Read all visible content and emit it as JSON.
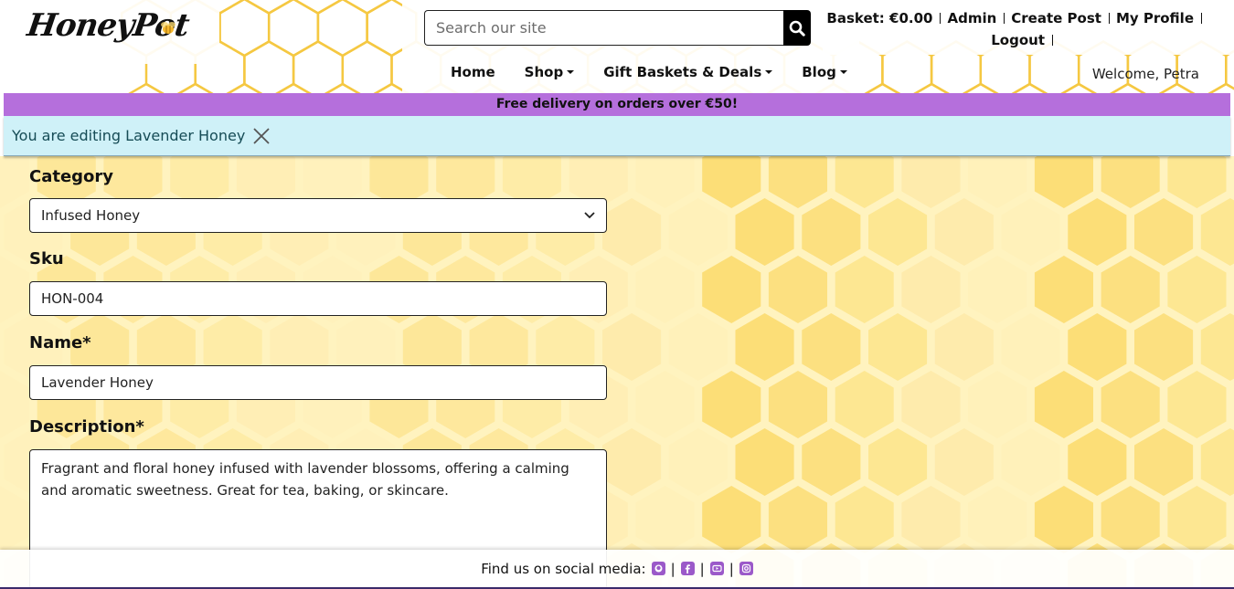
{
  "brand": {
    "logo_text": "HoneyPot",
    "accent": "#b56fdc",
    "honey": "#f5c842"
  },
  "search": {
    "placeholder": "Search our site"
  },
  "account": {
    "basket_label": "Basket: €0.00",
    "admin_label": "Admin",
    "create_post_label": "Create Post",
    "my_profile_label": "My Profile",
    "logout_label": "Logout"
  },
  "nav": {
    "home": "Home",
    "shop": "Shop",
    "gift_baskets": "Gift Baskets & Deals",
    "blog": "Blog"
  },
  "welcome": "Welcome, Petra",
  "promo": "Free delivery on orders over €50!",
  "alert": {
    "message": "You are editing Lavender Honey"
  },
  "form": {
    "category_label": "Category",
    "category_value": "Infused Honey",
    "sku_label": "Sku",
    "sku_value": "HON-004",
    "name_label": "Name*",
    "name_value": "Lavender Honey",
    "description_label": "Description*",
    "description_value": "Fragrant and floral honey infused with lavender blossoms, offering a calming and aromatic sweetness. Great for tea, baking, or skincare."
  },
  "footer": {
    "social_label": "Find us on social media:",
    "icons": [
      "github-icon",
      "facebook-icon",
      "youtube-icon",
      "instagram-icon"
    ]
  }
}
